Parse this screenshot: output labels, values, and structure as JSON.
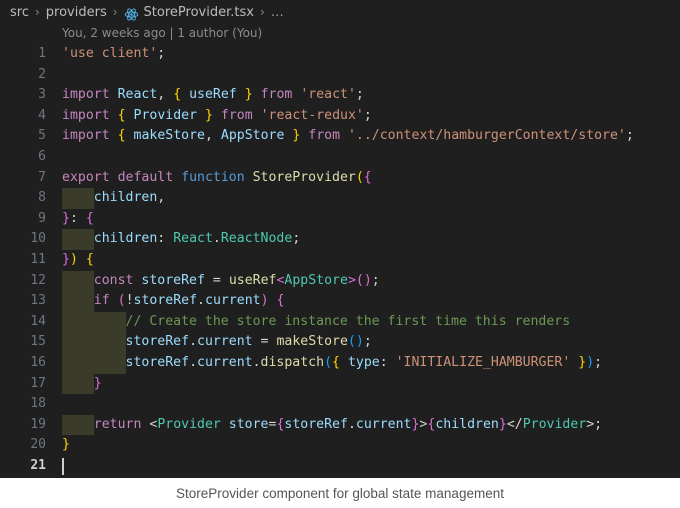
{
  "breadcrumb": {
    "segments": [
      "src",
      "providers",
      "StoreProvider.tsx"
    ],
    "separator": "›",
    "ellipsis": "…",
    "file_icon": "react-logo-icon"
  },
  "blame": {
    "text": "You, 2 weeks ago | 1 author (You)"
  },
  "caption": {
    "text": "StoreProvider component for global state management"
  },
  "editor": {
    "background": "#1f1f1f",
    "cursor_line": 21,
    "total_lines": 21,
    "lines": [
      {
        "n": "1",
        "indent": 0,
        "text": "'use client';"
      },
      {
        "n": "2",
        "indent": 0,
        "text": ""
      },
      {
        "n": "3",
        "indent": 0,
        "text": "import React, { useRef } from 'react';"
      },
      {
        "n": "4",
        "indent": 0,
        "text": "import { Provider } from 'react-redux';"
      },
      {
        "n": "5",
        "indent": 0,
        "text": "import { makeStore, AppStore } from '../context/hamburgerContext/store';"
      },
      {
        "n": "6",
        "indent": 0,
        "text": ""
      },
      {
        "n": "7",
        "indent": 0,
        "text": "export default function StoreProvider({"
      },
      {
        "n": "8",
        "indent": 1,
        "text": "  children,"
      },
      {
        "n": "9",
        "indent": 0,
        "text": "}: {"
      },
      {
        "n": "10",
        "indent": 1,
        "text": "  children: React.ReactNode;"
      },
      {
        "n": "11",
        "indent": 0,
        "text": "}) {"
      },
      {
        "n": "12",
        "indent": 1,
        "text": "  const storeRef = useRef<AppStore>();"
      },
      {
        "n": "13",
        "indent": 1,
        "text": "  if (!storeRef.current) {"
      },
      {
        "n": "14",
        "indent": 2,
        "text": "    // Create the store instance the first time this renders"
      },
      {
        "n": "15",
        "indent": 2,
        "text": "    storeRef.current = makeStore();"
      },
      {
        "n": "16",
        "indent": 2,
        "text": "    storeRef.current.dispatch({ type: 'INITIALIZE_HAMBURGER' });"
      },
      {
        "n": "17",
        "indent": 1,
        "text": "  }"
      },
      {
        "n": "18",
        "indent": 0,
        "text": ""
      },
      {
        "n": "19",
        "indent": 1,
        "text": "  return <Provider store={storeRef.current}>{children}</Provider>;"
      },
      {
        "n": "20",
        "indent": 0,
        "text": "}"
      },
      {
        "n": "21",
        "indent": 0,
        "text": ""
      }
    ]
  },
  "colors": {
    "keyword": "#c586c0",
    "function_keyword": "#569cd6",
    "identifier": "#9cdcfe",
    "string": "#ce9178",
    "comment": "#6a9955",
    "type": "#4ec9b0",
    "function_name": "#dcdcaa",
    "bracket1": "#ffd700",
    "bracket2": "#da70d6",
    "bracket3": "#179fff",
    "line_number": "#6e7681",
    "indent_guide": "#3b3b29",
    "background": "#1f1f1f",
    "react_blue": "#4fb3e8"
  }
}
